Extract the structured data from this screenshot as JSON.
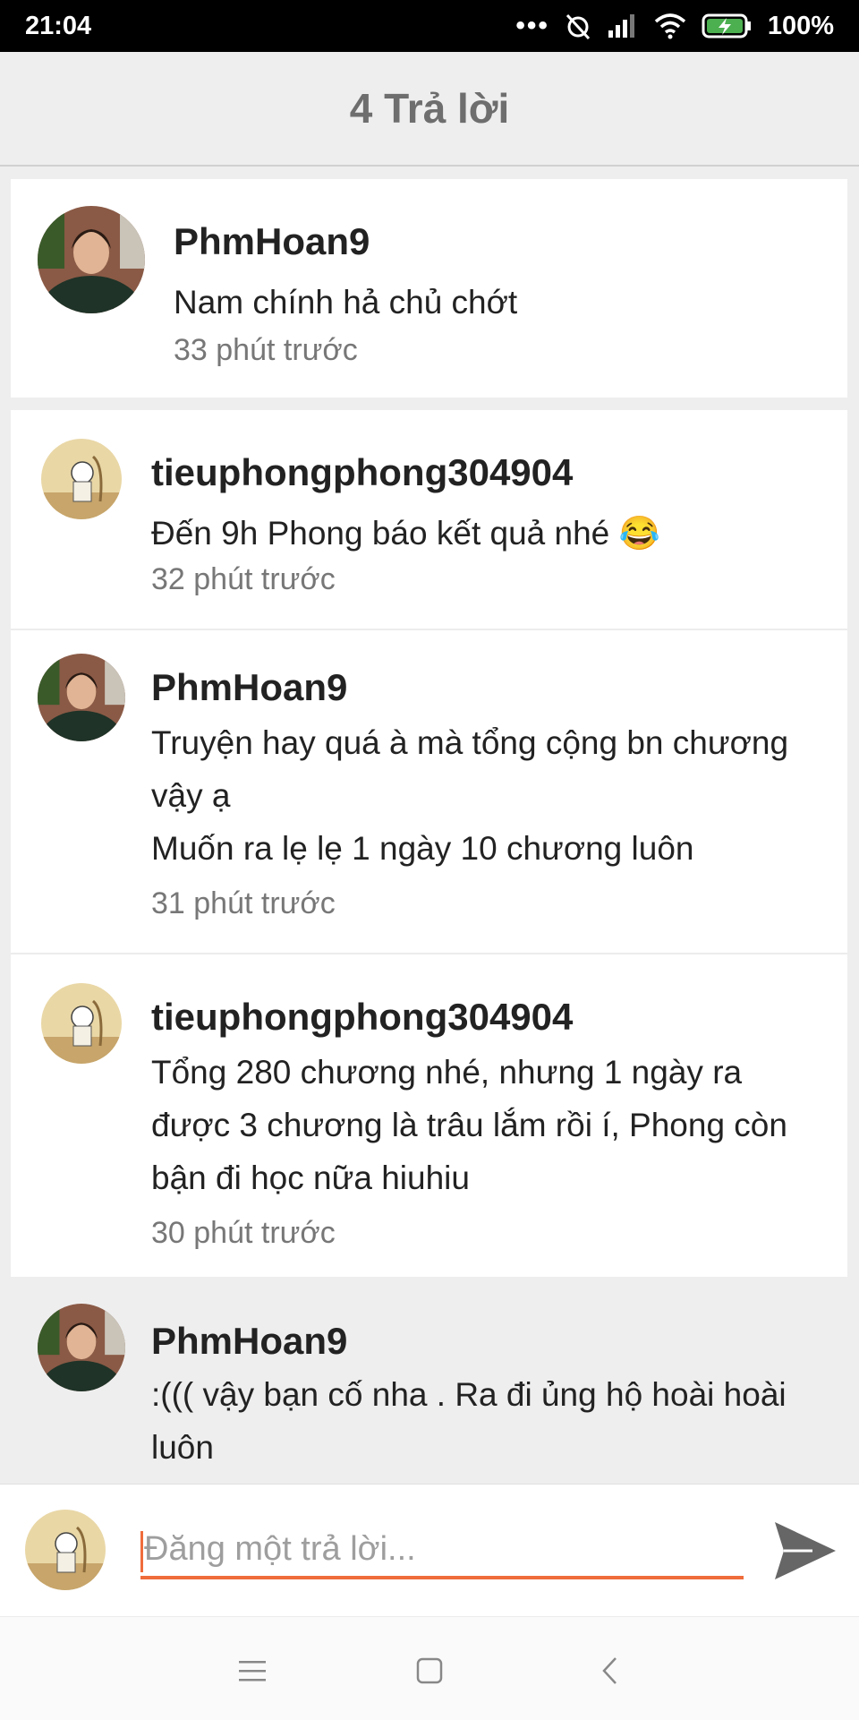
{
  "status_bar": {
    "time": "21:04",
    "battery": "100%"
  },
  "header": {
    "title": "4 Trả lời"
  },
  "root_comment": {
    "username": "PhmHoan9",
    "text": "Nam chính hả chủ chớt",
    "time": "33 phút trước"
  },
  "replies": [
    {
      "username": "tieuphongphong304904",
      "text": "Đến 9h Phong báo kết quả nhé 😂",
      "time": "32 phút trước"
    },
    {
      "username": "PhmHoan9",
      "text_lines": [
        "Truyện hay quá à mà tổng cộng bn chương",
        "vậy ạ",
        "Muốn ra lẹ lẹ 1 ngày 10 chương luôn"
      ],
      "time": "31 phút trước"
    },
    {
      "username": "tieuphongphong304904",
      "text_lines": [
        "Tổng 280 chương nhé, nhưng 1 ngày ra",
        "được 3 chương là trâu lắm rồi í, Phong còn",
        "bận đi học nữa hiuhiu"
      ],
      "time": "30 phút trước"
    },
    {
      "username": "PhmHoan9",
      "text_lines": [
        ":((( vậy bạn cố nha . Ra đi ủng hộ hoài hoài",
        "luôn"
      ]
    }
  ],
  "reply_input": {
    "placeholder": "Đăng một trả lời..."
  },
  "icons": {
    "send": "send-icon",
    "menu": "menu-icon",
    "home": "home-square-icon",
    "back": "back-chevron-icon"
  },
  "colors": {
    "accent": "#ef6c3b",
    "header_bg": "#eeeeee",
    "card_bg": "#ffffff"
  }
}
